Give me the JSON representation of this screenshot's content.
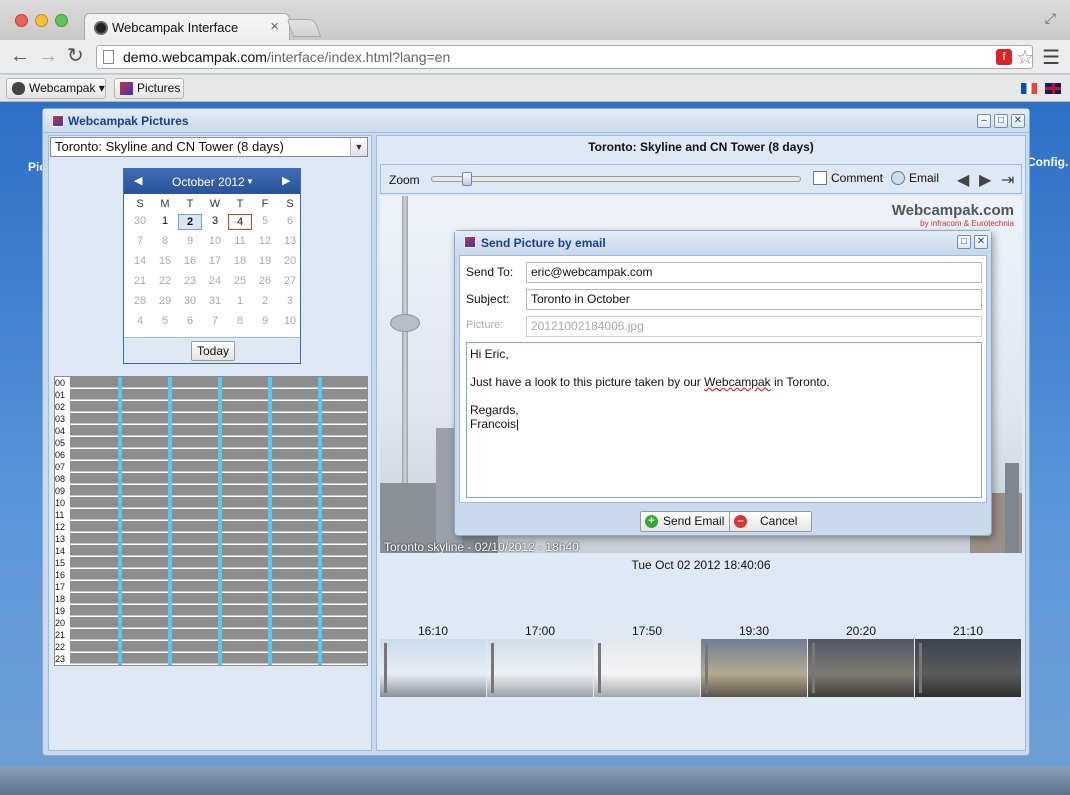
{
  "browser": {
    "tab_title": "Webcampak Interface",
    "tab_close": "×",
    "url_host": "demo.webcampak.com",
    "url_path": "/interface/index.html?lang=en",
    "bookmarks": [
      "Webcampak ▾",
      "Pictures"
    ]
  },
  "desktop": {
    "left_label": "Pic",
    "right_label": "Config."
  },
  "window": {
    "title": "Webcampak Pictures"
  },
  "left": {
    "source": "Toronto: Skyline and CN Tower (8 days)",
    "calendar": {
      "month": "October 2012",
      "weekdays": [
        "S",
        "M",
        "T",
        "W",
        "T",
        "F",
        "S"
      ],
      "days": [
        [
          "30",
          "1",
          "2",
          "3",
          "4",
          "5",
          "6"
        ],
        [
          "7",
          "8",
          "9",
          "10",
          "11",
          "12",
          "13"
        ],
        [
          "14",
          "15",
          "16",
          "17",
          "18",
          "19",
          "20"
        ],
        [
          "21",
          "22",
          "23",
          "24",
          "25",
          "26",
          "27"
        ],
        [
          "28",
          "29",
          "30",
          "31",
          "1",
          "2",
          "3"
        ],
        [
          "4",
          "5",
          "6",
          "7",
          "8",
          "9",
          "10"
        ]
      ],
      "today_label": "Today"
    },
    "hours": [
      "00",
      "01",
      "02",
      "03",
      "04",
      "05",
      "06",
      "07",
      "08",
      "09",
      "10",
      "11",
      "12",
      "13",
      "14",
      "15",
      "16",
      "17",
      "18",
      "19",
      "20",
      "21",
      "22",
      "23"
    ]
  },
  "right": {
    "title": "Toronto: Skyline and CN Tower (8 days)",
    "zoom_label": "Zoom",
    "comment_label": "Comment",
    "email_label": "Email",
    "logo_text": "Webcampak.com",
    "logo_sub": "by infracom & Eurotechnia",
    "caption": "Toronto skyline - 02/10/2012 - 18h40",
    "datetime": "Tue Oct 02 2012 18:40:06",
    "thumb_times": [
      "16:10",
      "17:00",
      "17:50",
      "19:30",
      "20:20",
      "21:10"
    ]
  },
  "dialog": {
    "title": "Send Picture by email",
    "send_to_label": "Send To:",
    "send_to_value": "eric@webcampak.com",
    "subject_label": "Subject:",
    "subject_value": "Toronto in October",
    "picture_label": "Picture:",
    "picture_value": "20121002184006.jpg",
    "message_greeting": "Hi Eric,",
    "message_line_pre": "Just have a look to this picture taken by our ",
    "message_word": "Webcampak",
    "message_line_post": " in Toronto.",
    "message_regards": "Regards,",
    "message_name": "Francois",
    "send_label": "Send Email",
    "cancel_label": "Cancel"
  },
  "colors": {
    "accent": "#15428b",
    "panel": "#dfe8f5",
    "hour_marker": "#5ac8ea"
  }
}
